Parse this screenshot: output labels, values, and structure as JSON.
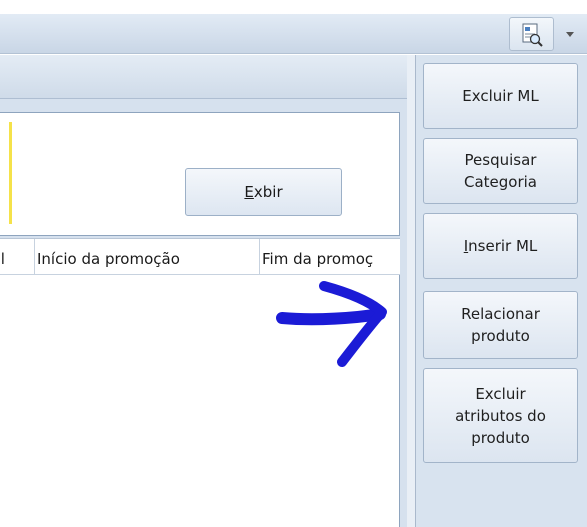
{
  "toolbar": {
    "icons": [
      "report-preview-icon",
      "dropdown-arrow-icon"
    ]
  },
  "filter": {
    "show_button": {
      "before": "",
      "accel": "E",
      "after": "xbir"
    }
  },
  "grid": {
    "columns": [
      "nal",
      "Início da promoção",
      "Fim da promoç"
    ]
  },
  "sidebar": {
    "buttons": [
      {
        "label": "Excluir ML"
      },
      {
        "label": "Pesquisar\nCategoria"
      },
      {
        "label_accel": "I",
        "label_rest": "nserir ML"
      },
      {
        "label": "Relacionar\nproduto"
      },
      {
        "label": "Excluir\natributos do\nproduto"
      }
    ]
  },
  "annotation": {
    "arrow_color": "#1b1bd6"
  }
}
